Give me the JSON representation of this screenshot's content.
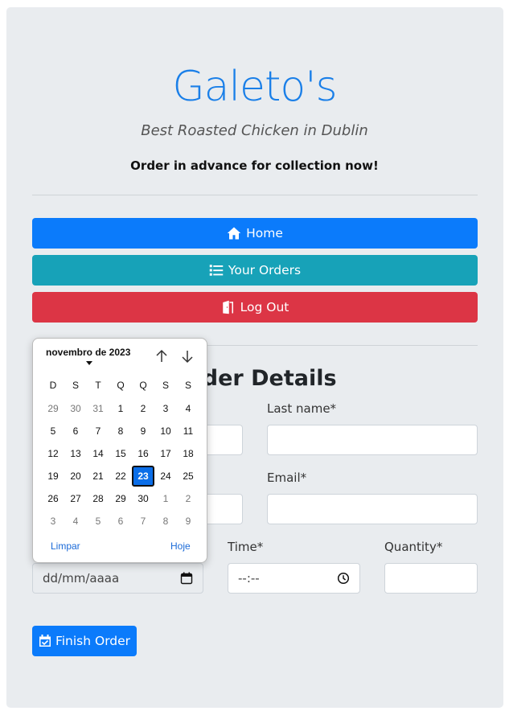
{
  "brand": {
    "title": "Galeto's",
    "subtitle": "Best Roasted Chicken in Dublin",
    "cta": "Order in advance for collection now!"
  },
  "nav": {
    "home": {
      "label": "Home",
      "icon": "home-icon",
      "color": "#0b7bfb"
    },
    "orders": {
      "label": "Your Orders",
      "icon": "list-icon",
      "color": "#17a2b8"
    },
    "logout": {
      "label": "Log Out",
      "icon": "door-exit-icon",
      "color": "#dc3545"
    }
  },
  "form": {
    "title": "Order Details",
    "last_name_label": "Last name*",
    "email_label": "Email*",
    "time_label": "Time*",
    "quantity_label": "Quantity*",
    "date_placeholder": "dd/mm/aaaa",
    "time_placeholder": "--:--",
    "finish_label": "Finish Order"
  },
  "datepicker": {
    "month_label": "novembro de 2023",
    "weekdays": [
      "D",
      "S",
      "T",
      "Q",
      "Q",
      "S",
      "S"
    ],
    "weeks": [
      [
        "29",
        "30",
        "31",
        "1",
        "2",
        "3",
        "4"
      ],
      [
        "5",
        "6",
        "7",
        "8",
        "9",
        "10",
        "11"
      ],
      [
        "12",
        "13",
        "14",
        "15",
        "16",
        "17",
        "18"
      ],
      [
        "19",
        "20",
        "21",
        "22",
        "23",
        "24",
        "25"
      ],
      [
        "26",
        "27",
        "28",
        "29",
        "30",
        "1",
        "2"
      ],
      [
        "3",
        "4",
        "5",
        "6",
        "7",
        "8",
        "9"
      ]
    ],
    "selected": "23",
    "clear_label": "Limpar",
    "today_label": "Hoje"
  }
}
